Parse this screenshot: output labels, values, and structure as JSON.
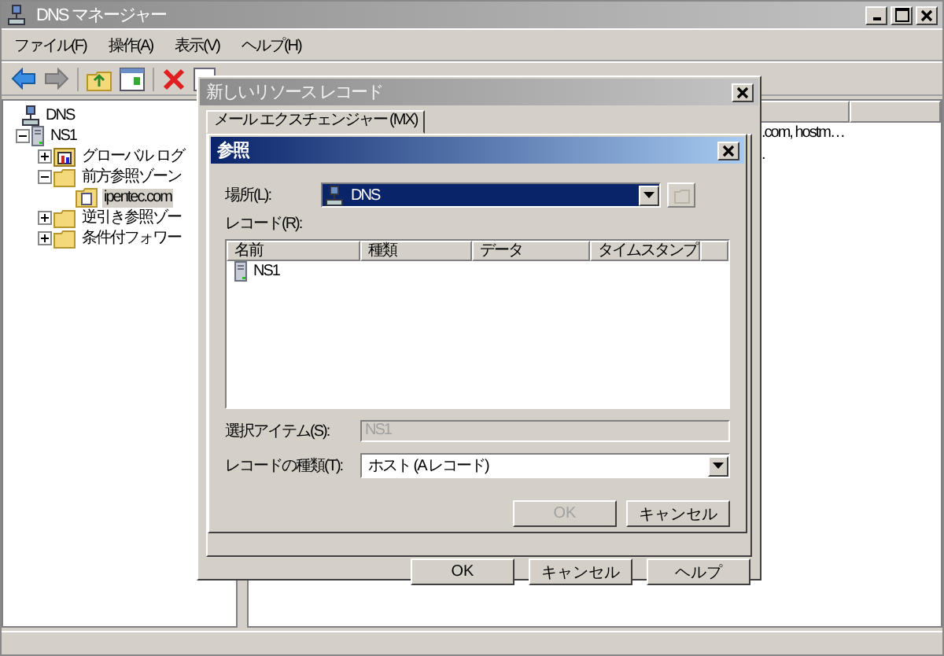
{
  "window": {
    "title": "DNS マネージャー"
  },
  "menu": [
    "ファイル(F)",
    "操作(A)",
    "表示(V)",
    "ヘルプ(H)"
  ],
  "tree": [
    {
      "label": "DNS",
      "kind": "root",
      "selected": false,
      "children": [
        {
          "label": "NS1",
          "kind": "server",
          "expanded": true,
          "selected": false,
          "children": [
            {
              "label": "グローバル ログ",
              "kind": "log",
              "expanded": false,
              "selected": false
            },
            {
              "label": "前方参照ゾーン",
              "kind": "folder",
              "expanded": true,
              "selected": false,
              "children": [
                {
                  "label": "ipentec.com",
                  "kind": "zone",
                  "selected": true
                }
              ]
            },
            {
              "label": "逆引き参照ゾー",
              "kind": "folder",
              "expanded": false,
              "selected": false
            },
            {
              "label": "条件付フォワー",
              "kind": "folder",
              "expanded": false,
              "selected": false
            }
          ]
        }
      ]
    }
  ],
  "right_pane": {
    "rows": [
      ".com, hostm…",
      "."
    ]
  },
  "dialog": {
    "title": "新しいリソース レコード",
    "tabs": [
      {
        "label": "メール エクスチェンジャー (MX)",
        "selected": true
      }
    ],
    "buttons": [
      {
        "label": "OK",
        "disabled": false
      },
      {
        "label": "キャンセル",
        "disabled": false
      },
      {
        "label": "ヘルプ",
        "disabled": false
      }
    ]
  },
  "browse_dialog": {
    "title": "参照",
    "location_label": "場所(L):",
    "location_value": "DNS",
    "records_label": "レコード(R):",
    "columns": [
      "名前",
      "種類",
      "データ",
      "タイムスタンプ"
    ],
    "records": [
      {
        "name": "NS1",
        "selected": false
      }
    ],
    "selected_item_label": "選択アイテム(S):",
    "selected_item_value": "NS1",
    "record_type_label": "レコードの種類(T):",
    "record_type_value": "ホスト (A レコード)",
    "buttons": [
      {
        "label": "OK",
        "disabled": true
      },
      {
        "label": "キャンセル",
        "disabled": false
      }
    ]
  }
}
